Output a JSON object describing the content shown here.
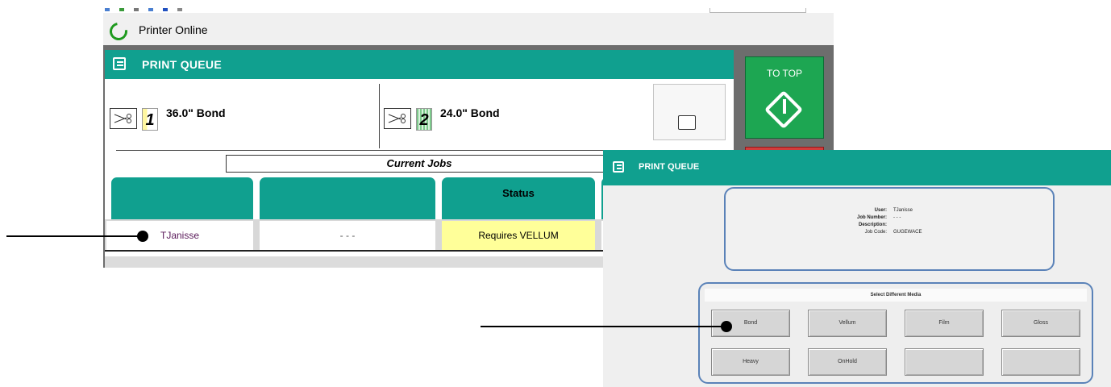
{
  "status": {
    "text": "Printer Online"
  },
  "queue": {
    "title": "PRINT QUEUE",
    "rolls": [
      {
        "number": "1",
        "label": "36.0\" Bond"
      },
      {
        "number": "2",
        "label": "24.0\" Bond"
      }
    ],
    "current_jobs_label": "Current Jobs",
    "columns": [
      "",
      "",
      "Status"
    ],
    "job": {
      "user": "TJanisse",
      "job_number": "- - -",
      "status": "Requires VELLUM"
    },
    "to_top_label": "TO TOP"
  },
  "dialog": {
    "title": "PRINT QUEUE",
    "info": [
      {
        "key": "User:",
        "value": "TJanisse"
      },
      {
        "key": "Job Number:",
        "value": "- - -"
      },
      {
        "key": "Description:",
        "value": ""
      },
      {
        "key": "Job Code:",
        "value": "GUGEWACE"
      }
    ],
    "select_title": "Select Different Media",
    "media_buttons": [
      "Bond",
      "Vellum",
      "Film",
      "Gloss",
      "Heavy",
      "OnHold",
      "",
      ""
    ]
  },
  "colors": {
    "header_teal": "#10a08f",
    "to_top_green": "#1da652",
    "status_yellow": "#ffff99",
    "dialog_border": "#5a82b8"
  }
}
